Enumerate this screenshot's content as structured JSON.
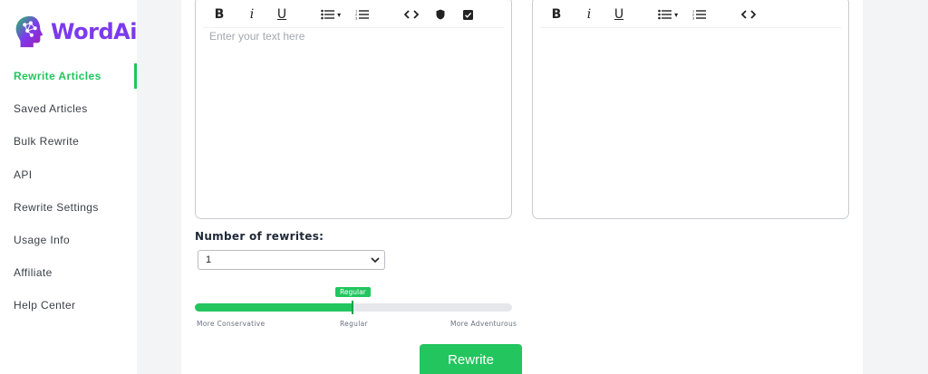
{
  "brand": {
    "name": "WordAi",
    "logo_icon": "brain-head-icon",
    "color": "#7c3aed",
    "accent": "#22c55e"
  },
  "sidebar": {
    "items": [
      {
        "label": "Rewrite Articles",
        "active": true
      },
      {
        "label": "Saved Articles",
        "active": false
      },
      {
        "label": "Bulk Rewrite",
        "active": false
      },
      {
        "label": "API",
        "active": false
      },
      {
        "label": "Rewrite Settings",
        "active": false
      },
      {
        "label": "Usage Info",
        "active": false
      },
      {
        "label": "Affiliate",
        "active": false
      },
      {
        "label": "Help Center",
        "active": false
      }
    ]
  },
  "input_editor": {
    "placeholder": "Enter your text here",
    "toolbar": {
      "bold": "B",
      "italic": "i",
      "underline": "U"
    }
  },
  "output_editor": {
    "toolbar": {
      "bold": "B",
      "italic": "i",
      "underline": "U"
    }
  },
  "rewrites": {
    "label": "Number of rewrites:",
    "selected": "1"
  },
  "slider": {
    "current_label": "Regular",
    "left_label": "More Conservative",
    "mid_label": "Regular",
    "right_label": "More Adventurous",
    "value_fraction": 0.5
  },
  "rewrite_button": {
    "label": "Rewrite"
  }
}
